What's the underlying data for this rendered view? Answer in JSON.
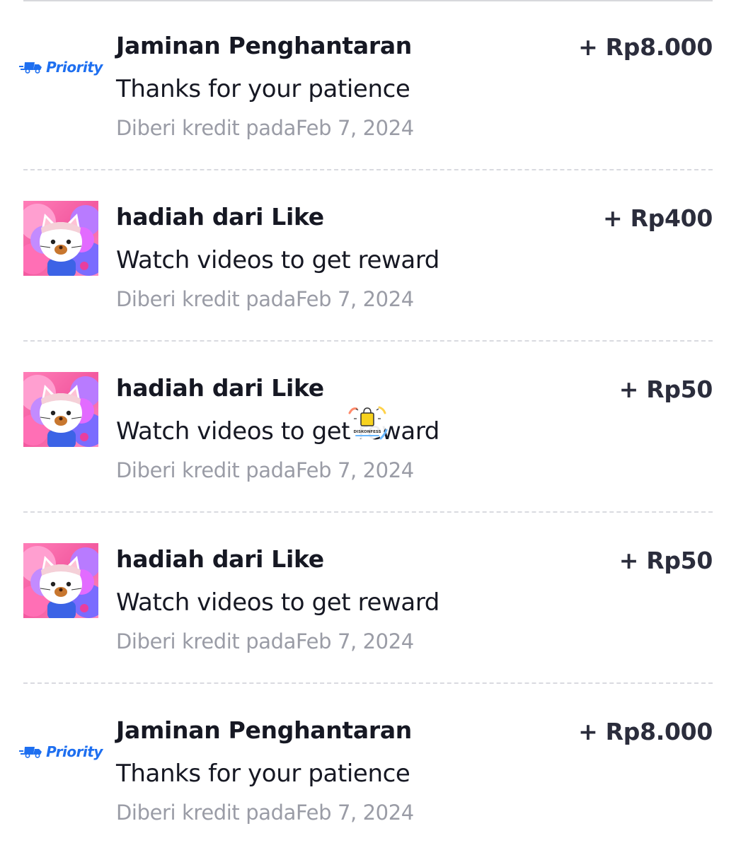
{
  "transactions": [
    {
      "icon": "priority-delivery-icon",
      "badge_text": "Priority",
      "title": "Jaminan Penghantaran",
      "subtitle": "Thanks for your patience",
      "meta_prefix": "Diberi kredit pada",
      "date": "Feb 7, 2024",
      "amount": "+ Rp8.000"
    },
    {
      "icon": "cat-avatar-icon",
      "title": "hadiah dari Like",
      "subtitle": "Watch videos to get reward",
      "meta_prefix": "Diberi kredit pada",
      "date": "Feb 7, 2024",
      "amount": "+ Rp400"
    },
    {
      "icon": "cat-avatar-icon",
      "title": "hadiah dari Like",
      "subtitle": "Watch videos to get reward",
      "meta_prefix": "Diberi kredit pada",
      "date": "Feb 7, 2024",
      "amount": "+ Rp50"
    },
    {
      "icon": "cat-avatar-icon",
      "title": "hadiah dari Like",
      "subtitle": "Watch videos to get reward",
      "meta_prefix": "Diberi kredit pada",
      "date": "Feb 7, 2024",
      "amount": "+ Rp50"
    },
    {
      "icon": "priority-delivery-icon",
      "badge_text": "Priority",
      "title": "Jaminan Penghantaran",
      "subtitle": "Thanks for your patience",
      "meta_prefix": "Diberi kredit pada",
      "date": "Feb 7, 2024",
      "amount": "+ Rp8.000"
    }
  ],
  "watermark": {
    "text": "DISKONFESS",
    "icon": "shopping-bag-icon"
  },
  "colors": {
    "title": "#161823",
    "meta": "#9a9ca6",
    "amount": "#2b2d3c",
    "priority": "#1e6ff0",
    "avatar_bg": "#f35aa0",
    "separator": "#d9dae0"
  }
}
